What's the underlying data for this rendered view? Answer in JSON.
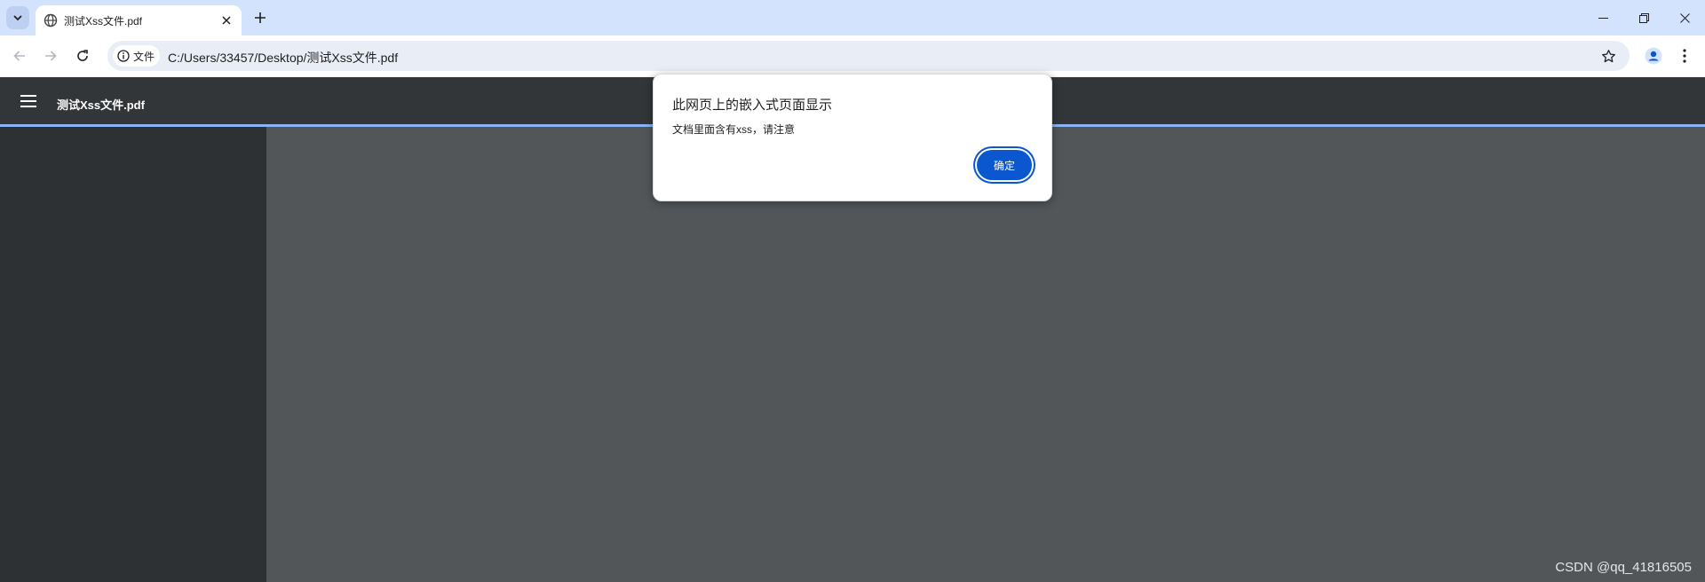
{
  "browser": {
    "tab": {
      "title": "测试Xss文件.pdf",
      "favicon": "globe-icon"
    },
    "new_tab_symbol": "+",
    "address_bar": {
      "site_chip_label": "文件",
      "url": "C:/Users/33457/Desktop/测试Xss文件.pdf"
    }
  },
  "pdf_viewer": {
    "file_title": "测试Xss文件.pdf",
    "accent_color": "#8ab4f8"
  },
  "dialog": {
    "title": "此网页上的嵌入式页面显示",
    "message": "文档里面含有xss，请注意",
    "ok_label": "确定",
    "button_color": "#0b57d0"
  },
  "watermark": "CSDN @qq_41816505"
}
